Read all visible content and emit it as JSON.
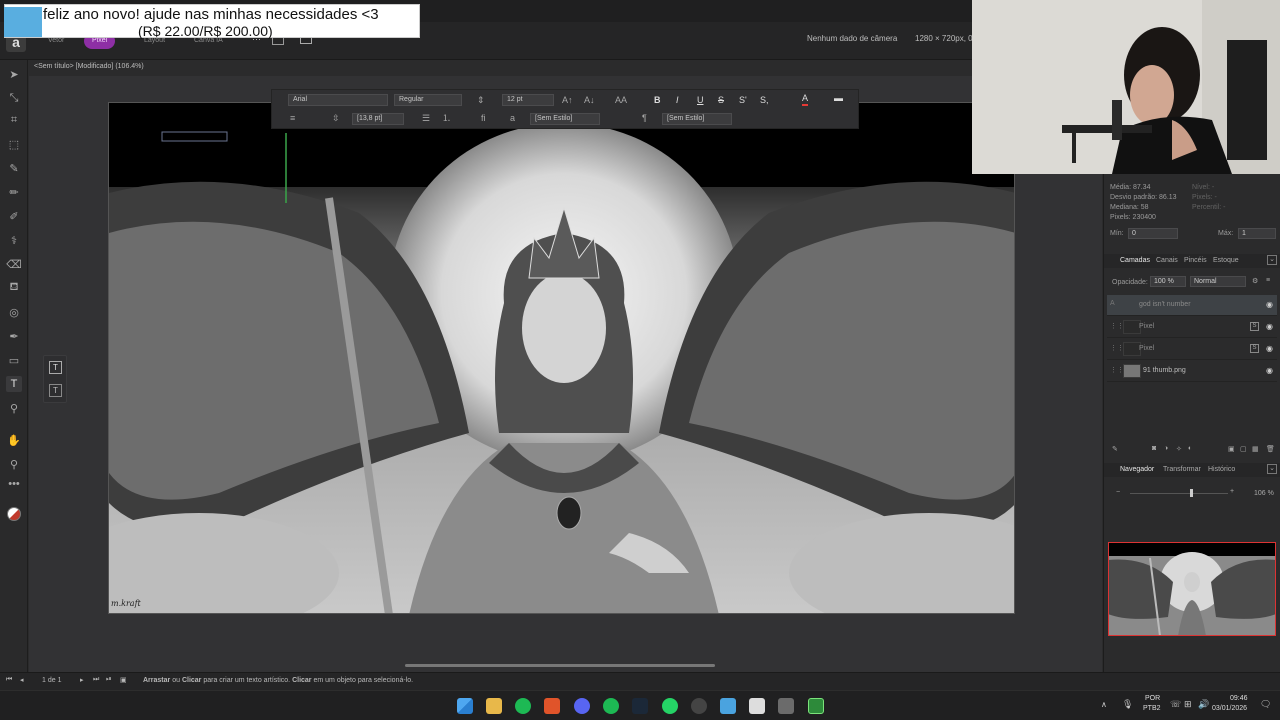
{
  "donation": {
    "line1": "feliz ano novo! ajude nas minhas necessidades <3",
    "line2": "(R$ 22.00/R$ 200.00)"
  },
  "personas": {
    "vector": "Vetor",
    "pixel": "Pixel",
    "layout": "Layout",
    "canva": "Canva IA"
  },
  "camera": {
    "info": "Nenhum dado de câmera",
    "size": "1280 × 720px, 0"
  },
  "document": {
    "title": "<Sem título> [Modificado] (106.4%)"
  },
  "textbar": {
    "font": "Arial",
    "weight": "Regular",
    "size": "12 pt",
    "leading": "[13,8 pt]",
    "char_style": "[Sem Estilo]",
    "para_style": "[Sem Estilo]",
    "b": "B",
    "i": "I",
    "u": "U",
    "s": "S",
    "sup": "S'",
    "sub": "S,"
  },
  "stats": {
    "media": "Média: 87.34",
    "desvio": "Desvio padrão: 86.13",
    "mediana": "Mediana: 58",
    "pixels": "Pixels: 230400",
    "nivel": "Nível: -",
    "pixels2": "Pixels: -",
    "percentil": "Percentil: -",
    "min_label": "Mín:",
    "min_val": "0",
    "max_label": "Máx:",
    "max_val": "1"
  },
  "layers_panel": {
    "tabs": [
      "Camadas",
      "Canais",
      "Pincéis",
      "Estoque"
    ],
    "opacity_label": "Opacidade:",
    "opacity": "100 %",
    "blend": "Normal",
    "layers": [
      {
        "name": "god isn't number",
        "icon": "A"
      },
      {
        "name": "Pixel"
      },
      {
        "name": "Pixel"
      },
      {
        "name": "91 thumb.png"
      }
    ]
  },
  "nav_panel": {
    "tabs": [
      "Navegador",
      "Transformar",
      "Histórico"
    ],
    "zoom": "106 %"
  },
  "status": {
    "page": "1 de 1",
    "hint_bold1": "Arrastar",
    "hint_t1": " ou ",
    "hint_bold2": "Clicar",
    "hint_t2": " para criar um texto artístico. ",
    "hint_bold3": "Clicar",
    "hint_t3": " em um objeto para selecioná-lo."
  },
  "tray": {
    "lang": "POR",
    "layout": "PTB2",
    "time": "09:46",
    "date": "03/01/2026"
  },
  "artwork": {
    "signature": "m.kraft"
  },
  "colors": {
    "pixel_persona": "#8e2fa5",
    "accent_layer": "#3e4246"
  }
}
